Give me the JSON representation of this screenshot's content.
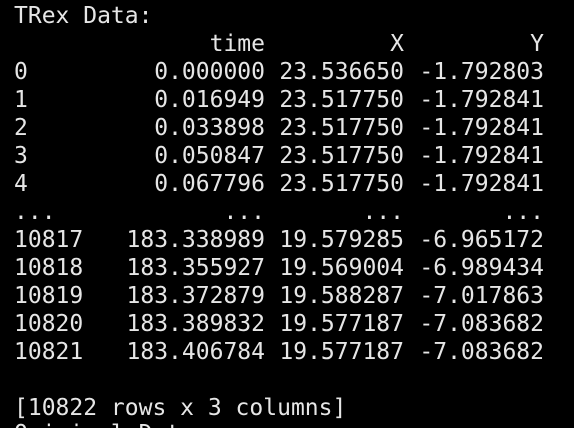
{
  "terminal": {
    "top_cutoff": "...",
    "label": "TRex Data:",
    "headers": {
      "index": "",
      "time": "time",
      "x": "X",
      "y": "Y"
    },
    "rows": [
      {
        "index": "0",
        "time": "0.000000",
        "x": "23.536650",
        "y": "-1.792803"
      },
      {
        "index": "1",
        "time": "0.016949",
        "x": "23.517750",
        "y": "-1.792841"
      },
      {
        "index": "2",
        "time": "0.033898",
        "x": "23.517750",
        "y": "-1.792841"
      },
      {
        "index": "3",
        "time": "0.050847",
        "x": "23.517750",
        "y": "-1.792841"
      },
      {
        "index": "4",
        "time": "0.067796",
        "x": "23.517750",
        "y": "-1.792841"
      },
      {
        "index": "...",
        "time": "...",
        "x": "...",
        "y": "..."
      },
      {
        "index": "10817",
        "time": "183.338989",
        "x": "19.579285",
        "y": "-6.965172"
      },
      {
        "index": "10818",
        "time": "183.355927",
        "x": "19.569004",
        "y": "-6.989434"
      },
      {
        "index": "10819",
        "time": "183.372879",
        "x": "19.588287",
        "y": "-7.017863"
      },
      {
        "index": "10820",
        "time": "183.389832",
        "x": "19.577187",
        "y": "-7.083682"
      },
      {
        "index": "10821",
        "time": "183.406784",
        "x": "19.577187",
        "y": "-7.083682"
      }
    ],
    "summary": "[10822 rows x 3 columns]",
    "bottom_cutoff": "Original Data:"
  },
  "colors": {
    "background": "#000000",
    "text": "#e6e6e6"
  }
}
